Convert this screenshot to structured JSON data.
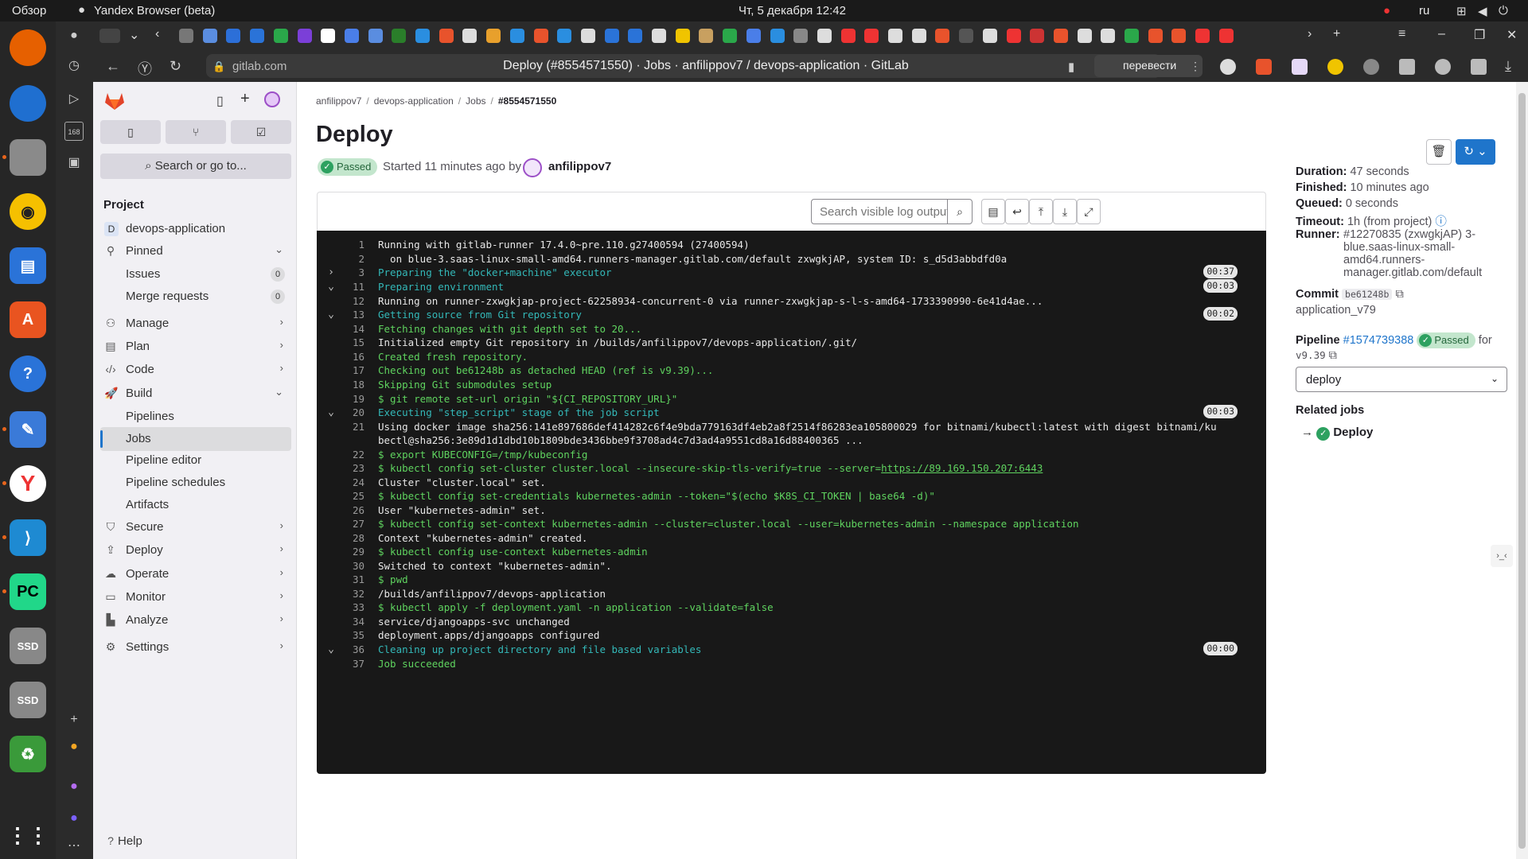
{
  "os": {
    "activities": "Обзор",
    "app_name": "Yandex Browser (beta)",
    "clock": "Чт, 5 декабря  12:42",
    "lang": "ru"
  },
  "browser": {
    "domain": "gitlab.com",
    "page_title": "Deploy (#8554571550) · Jobs · anfilippov7 / devops-application · GitLab",
    "translate_label": "перевести",
    "side_badge": "168"
  },
  "sidebar": {
    "search_label": "Search or go to...",
    "project_heading": "Project",
    "project_letter": "D",
    "project_name": "devops-application",
    "pinned": "Pinned",
    "issues": "Issues",
    "issues_count": "0",
    "merge_requests": "Merge requests",
    "mr_count": "0",
    "manage": "Manage",
    "plan": "Plan",
    "code": "Code",
    "build": "Build",
    "pipelines": "Pipelines",
    "jobs": "Jobs",
    "pipeline_editor": "Pipeline editor",
    "pipeline_schedules": "Pipeline schedules",
    "artifacts": "Artifacts",
    "secure": "Secure",
    "deploy": "Deploy",
    "operate": "Operate",
    "monitor": "Monitor",
    "analyze": "Analyze",
    "settings": "Settings",
    "help": "Help"
  },
  "breadcrumb": {
    "user": "anfilippov7",
    "project": "devops-application",
    "jobs": "Jobs",
    "job_id": "#8554571550"
  },
  "job": {
    "title": "Deploy",
    "status": "Passed",
    "started_text": "Started 11 minutes ago by",
    "user": "anfilippov7"
  },
  "log": {
    "search_placeholder": "Search visible log output",
    "lines": [
      {
        "n": "1",
        "t": "Running with gitlab-runner 17.4.0~pre.110.g27400594 (27400594)",
        "s": "",
        "tog": "",
        "dur": ""
      },
      {
        "n": "2",
        "t": "  on blue-3.saas-linux-small-amd64.runners-manager.gitlab.com/default zxwgkjAP, system ID: s_d5d3abbdfd0a",
        "s": "",
        "tog": "",
        "dur": ""
      },
      {
        "n": "3",
        "t": "Preparing the \"docker+machine\" executor",
        "s": "sec",
        "tog": "›",
        "dur": "00:37"
      },
      {
        "n": "11",
        "t": "Preparing environment",
        "s": "sec",
        "tog": "⌄",
        "dur": "00:03"
      },
      {
        "n": "12",
        "t": "Running on runner-zxwgkjap-project-62258934-concurrent-0 via runner-zxwgkjap-s-l-s-amd64-1733390990-6e41d4ae...",
        "s": "",
        "tog": "",
        "dur": ""
      },
      {
        "n": "13",
        "t": "Getting source from Git repository",
        "s": "sec",
        "tog": "⌄",
        "dur": "00:02"
      },
      {
        "n": "14",
        "t": "Fetching changes with git depth set to 20...",
        "s": "grn",
        "tog": "",
        "dur": ""
      },
      {
        "n": "15",
        "t": "Initialized empty Git repository in /builds/anfilippov7/devops-application/.git/",
        "s": "",
        "tog": "",
        "dur": ""
      },
      {
        "n": "16",
        "t": "Created fresh repository.",
        "s": "grn",
        "tog": "",
        "dur": ""
      },
      {
        "n": "17",
        "t": "Checking out be61248b as detached HEAD (ref is v9.39)...",
        "s": "grn",
        "tog": "",
        "dur": ""
      },
      {
        "n": "18",
        "t": "Skipping Git submodules setup",
        "s": "grn",
        "tog": "",
        "dur": ""
      },
      {
        "n": "19",
        "t": "$ git remote set-url origin \"${CI_REPOSITORY_URL}\"",
        "s": "grn",
        "tog": "",
        "dur": ""
      },
      {
        "n": "20",
        "t": "Executing \"step_script\" stage of the job script",
        "s": "sec",
        "tog": "⌄",
        "dur": "00:03"
      },
      {
        "n": "21",
        "t": "Using docker image sha256:141e897686def414282c6f4e9bda779163df4eb2a8f2514f86283ea105800029 for bitnami/kubectl:latest with digest bitnami/ku",
        "s": "",
        "tog": "",
        "dur": ""
      },
      {
        "n": "",
        "t": "bectl@sha256:3e89d1d1dbd10b1809bde3436bbe9f3708ad4c7d3ad4a9551cd8a16d88400365 ...",
        "s": "",
        "tog": "",
        "dur": ""
      },
      {
        "n": "22",
        "t": "$ export KUBECONFIG=/tmp/kubeconfig",
        "s": "grn",
        "tog": "",
        "dur": ""
      },
      {
        "n": "23",
        "t": "$ kubectl config set-cluster cluster.local --insecure-skip-tls-verify=true --server=",
        "s": "grn",
        "tog": "",
        "dur": "",
        "link": "https://89.169.150.207:6443"
      },
      {
        "n": "24",
        "t": "Cluster \"cluster.local\" set.",
        "s": "",
        "tog": "",
        "dur": ""
      },
      {
        "n": "25",
        "t": "$ kubectl config set-credentials kubernetes-admin --token=\"$(echo $K8S_CI_TOKEN | base64 -d)\"",
        "s": "grn",
        "tog": "",
        "dur": ""
      },
      {
        "n": "26",
        "t": "User \"kubernetes-admin\" set.",
        "s": "",
        "tog": "",
        "dur": ""
      },
      {
        "n": "27",
        "t": "$ kubectl config set-context kubernetes-admin --cluster=cluster.local --user=kubernetes-admin --namespace application",
        "s": "grn",
        "tog": "",
        "dur": ""
      },
      {
        "n": "28",
        "t": "Context \"kubernetes-admin\" created.",
        "s": "",
        "tog": "",
        "dur": ""
      },
      {
        "n": "29",
        "t": "$ kubectl config use-context kubernetes-admin",
        "s": "grn",
        "tog": "",
        "dur": ""
      },
      {
        "n": "30",
        "t": "Switched to context \"kubernetes-admin\".",
        "s": "",
        "tog": "",
        "dur": ""
      },
      {
        "n": "31",
        "t": "$ pwd",
        "s": "grn",
        "tog": "",
        "dur": ""
      },
      {
        "n": "32",
        "t": "/builds/anfilippov7/devops-application",
        "s": "",
        "tog": "",
        "dur": ""
      },
      {
        "n": "33",
        "t": "$ kubectl apply -f deployment.yaml -n application --validate=false",
        "s": "grn",
        "tog": "",
        "dur": ""
      },
      {
        "n": "34",
        "t": "service/djangoapps-svc unchanged",
        "s": "",
        "tog": "",
        "dur": ""
      },
      {
        "n": "35",
        "t": "deployment.apps/djangoapps configured",
        "s": "",
        "tog": "",
        "dur": ""
      },
      {
        "n": "36",
        "t": "Cleaning up project directory and file based variables",
        "s": "sec",
        "tog": "⌄",
        "dur": "00:00"
      },
      {
        "n": "37",
        "t": "Job succeeded",
        "s": "grn",
        "tog": "",
        "dur": ""
      }
    ]
  },
  "details": {
    "duration_label": "Duration:",
    "duration": "47 seconds",
    "finished_label": "Finished:",
    "finished": "10 minutes ago",
    "queued_label": "Queued:",
    "queued": "0 seconds",
    "timeout_label": "Timeout:",
    "timeout": "1h (from project)",
    "runner_label": "Runner:",
    "runner_l1": "#12270835 (zxwgkjAP) 3-",
    "runner_l2": "blue.saas-linux-small-",
    "runner_l3": "amd64.runners-",
    "runner_l4": "manager.gitlab.com/default",
    "commit_label": "Commit",
    "commit_sha": "be61248b",
    "commit_msg": "application_v79",
    "pipeline_label": "Pipeline",
    "pipeline_id": "#1574739388",
    "pipeline_status": "Passed",
    "pipeline_for": "for",
    "pipeline_ref": "v9.39",
    "stage": "deploy",
    "related_heading": "Related jobs",
    "related_job": "Deploy"
  },
  "colors": {
    "accent": "#1f75cb",
    "success": "#2da160",
    "log_bg": "#181818",
    "section": "#33b8b8",
    "green_text": "#5fd35f"
  }
}
